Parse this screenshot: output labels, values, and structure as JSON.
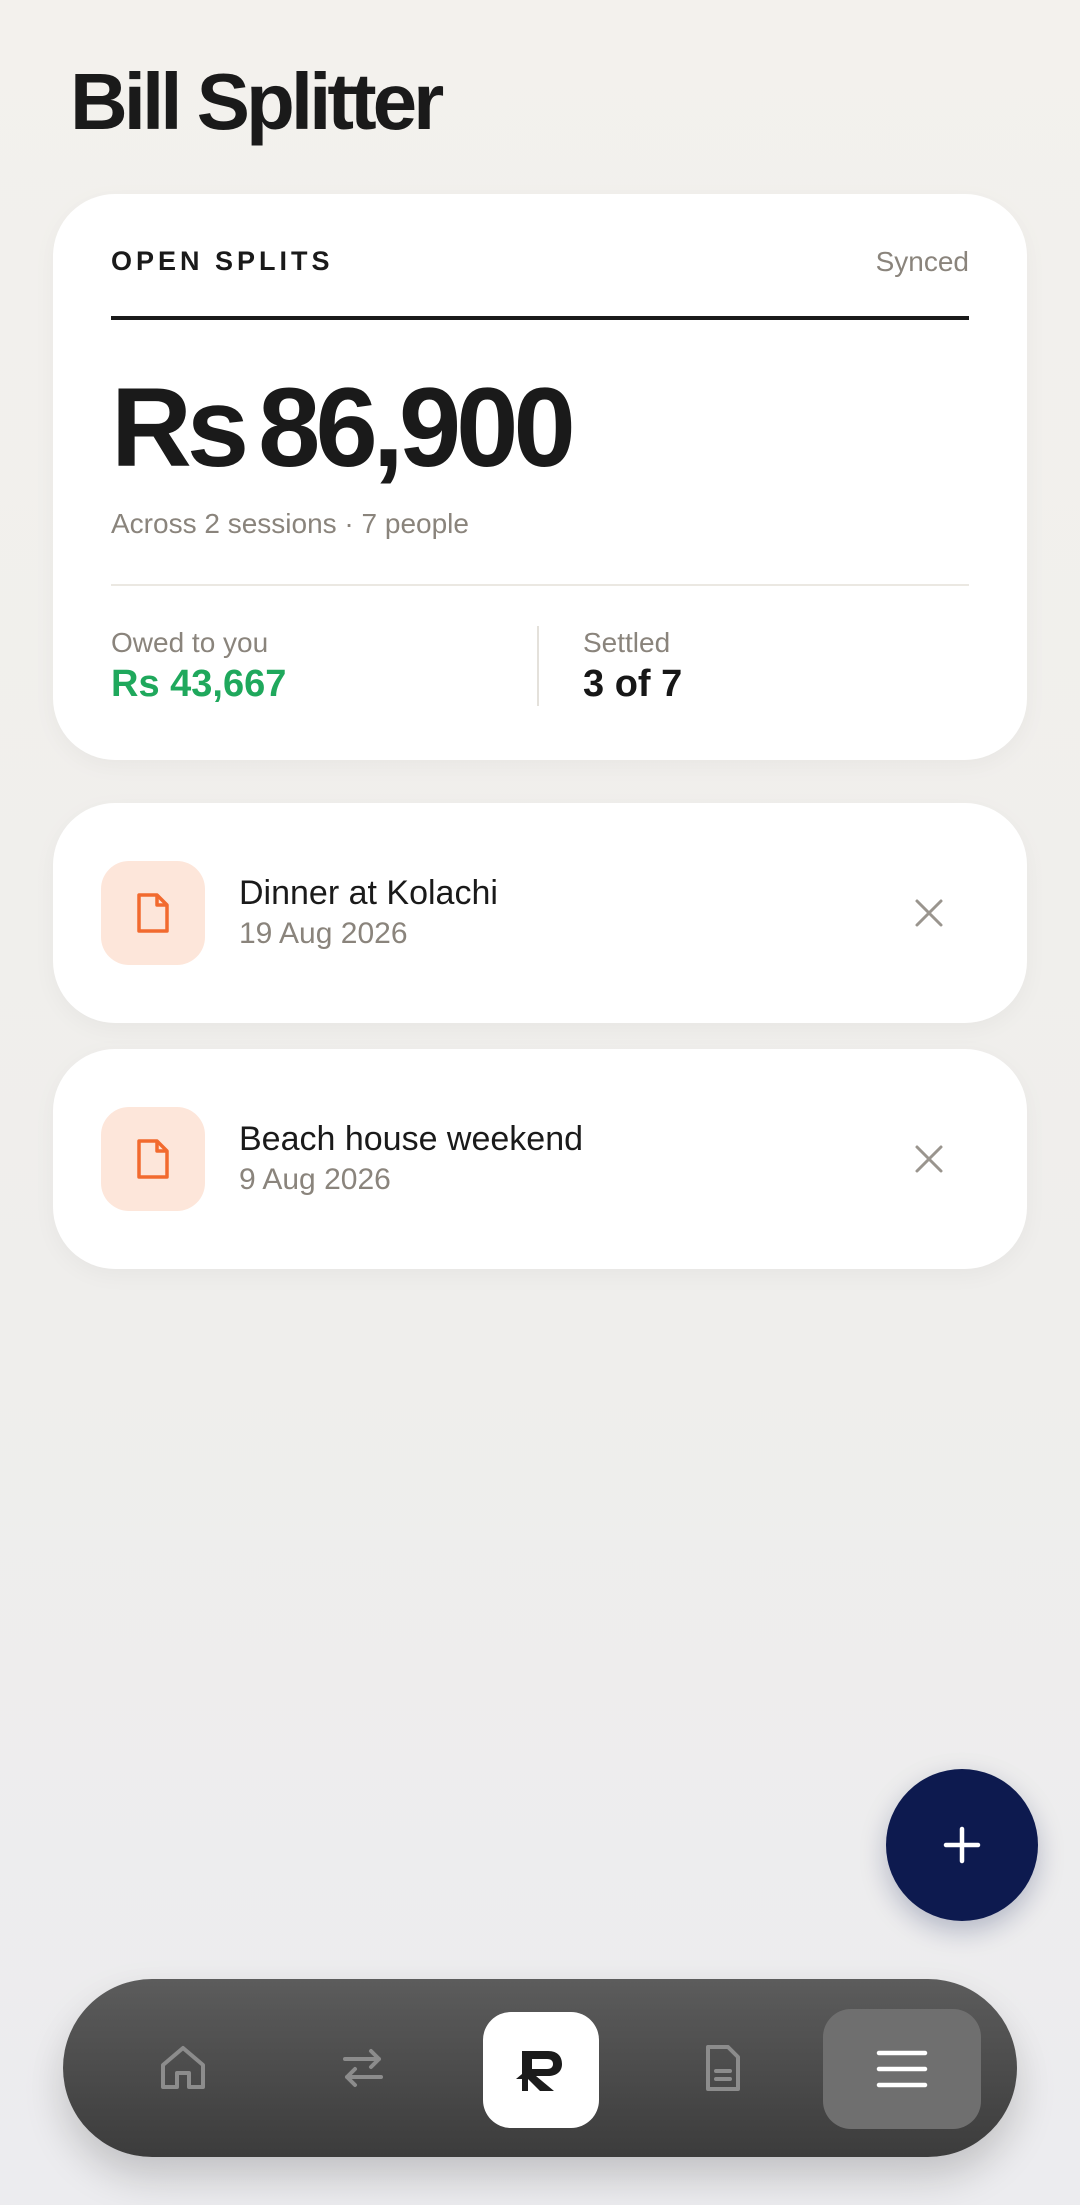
{
  "app": {
    "title": "Bill Splitter"
  },
  "summary": {
    "label": "OPEN SPLITS",
    "status": "Synced",
    "amount_currency": "Rs",
    "amount_value": "86,900",
    "subline": "Across 2 sessions · 7 people",
    "owed_label": "Owed to you",
    "owed_value": "Rs 43,667",
    "settled_label": "Settled",
    "settled_value": "3 of 7"
  },
  "splits": [
    {
      "name": "Dinner at Kolachi",
      "date": "19 Aug 2026",
      "icon": "document-icon"
    },
    {
      "name": "Beach house weekend",
      "date": "9 Aug 2026",
      "icon": "document-icon"
    }
  ],
  "fab": {
    "icon": "plus-icon"
  },
  "nav": {
    "items": [
      "home-icon",
      "transfer-icon",
      "app-logo",
      "document-icon",
      "menu-icon"
    ],
    "active": "menu"
  },
  "colors": {
    "accent_green": "#1fa85c",
    "accent_orange": "#f26a2e",
    "fab_navy": "#0d1a4f"
  }
}
